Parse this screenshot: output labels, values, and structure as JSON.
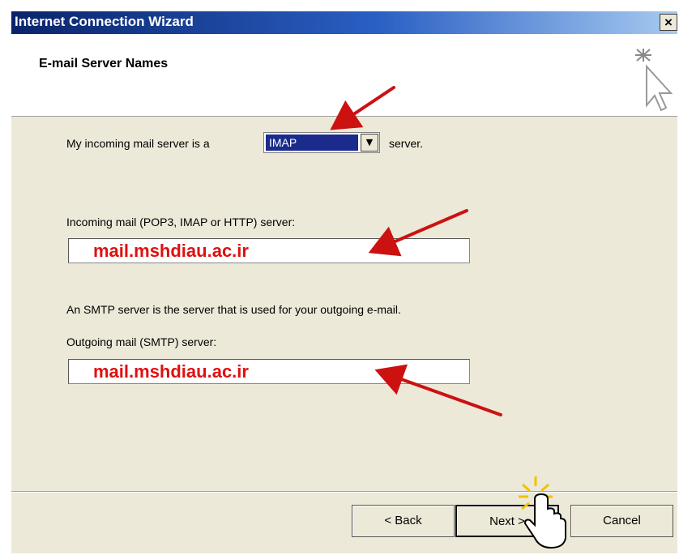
{
  "window": {
    "title": "Internet Connection Wizard",
    "close_label": "×"
  },
  "header": {
    "title": "E-mail Server Names",
    "icon": "wizard-cursor-sparkle-icon"
  },
  "incoming_type": {
    "prefix": "My incoming mail server is a",
    "selected": "IMAP",
    "suffix": "server."
  },
  "incoming_server": {
    "label": "Incoming mail (POP3, IMAP or HTTP) server:",
    "value": "mail.mshdiau.ac.ir"
  },
  "smtp_note": "An SMTP server is the server that is used for your outgoing e-mail.",
  "outgoing_server": {
    "label": "Outgoing mail (SMTP) server:",
    "value": "mail.mshdiau.ac.ir"
  },
  "buttons": {
    "back": "< Back",
    "next": "Next >",
    "cancel": "Cancel"
  },
  "colors": {
    "annotation_red": "#cc1111",
    "title_blue": "#0a246a",
    "value_red": "#e01010"
  }
}
